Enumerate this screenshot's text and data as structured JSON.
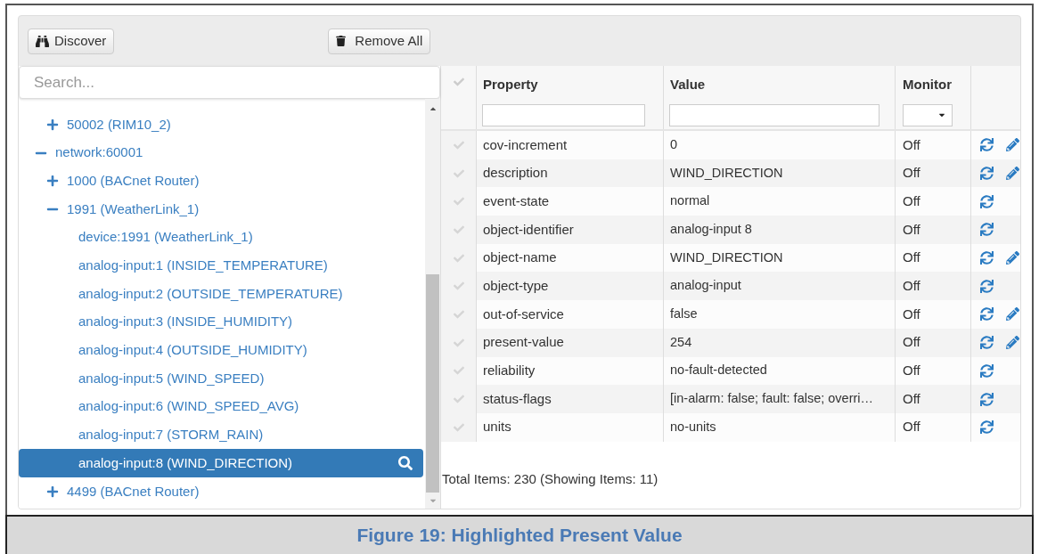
{
  "toolbar": {
    "buttons": [
      {
        "kind": "discover",
        "label": "Discover"
      },
      {
        "kind": "remove",
        "label": "Remove All"
      }
    ]
  },
  "tree": {
    "search": {
      "placeholder": "Search..."
    },
    "scrolled_branch": [
      {
        "label": "50002 (RIM10_2)",
        "expanded": false,
        "selected": false
      }
    ],
    "nodes": [
      {
        "label": "network:60001",
        "expanded": true,
        "selected": false,
        "children": [
          {
            "label": "1000 (BACnet Router)",
            "expanded": false,
            "selected": false
          },
          {
            "label": "1991 (WeatherLink_1)",
            "expanded": true,
            "selected": false,
            "children": [
              {
                "label": "device:1991 (WeatherLink_1)",
                "selected": false
              },
              {
                "label": "analog-input:1 (INSIDE_TEMPERATURE)",
                "selected": false
              },
              {
                "label": "analog-input:2 (OUTSIDE_TEMPERATURE)",
                "selected": false
              },
              {
                "label": "analog-input:3 (INSIDE_HUMIDITY)",
                "selected": false
              },
              {
                "label": "analog-input:4 (OUTSIDE_HUMIDITY)",
                "selected": false
              },
              {
                "label": "analog-input:5 (WIND_SPEED)",
                "selected": false
              },
              {
                "label": "analog-input:6 (WIND_SPEED_AVG)",
                "selected": false
              },
              {
                "label": "analog-input:7 (STORM_RAIN)",
                "selected": false
              },
              {
                "label": "analog-input:8 (WIND_DIRECTION)",
                "selected": true
              }
            ]
          },
          {
            "label": "4499 (BACnet Router)",
            "expanded": false,
            "selected": false
          }
        ]
      }
    ]
  },
  "table": {
    "columns": [
      "Property",
      "Value",
      "Monitor"
    ],
    "rows": [
      {
        "property": "cov-increment",
        "value": "0",
        "monitor": "Off",
        "editable": true
      },
      {
        "property": "description",
        "value": "WIND_DIRECTION",
        "monitor": "Off",
        "editable": true
      },
      {
        "property": "event-state",
        "value": "normal",
        "monitor": "Off",
        "editable": false
      },
      {
        "property": "object-identifier",
        "value": "analog-input 8",
        "monitor": "Off",
        "editable": false
      },
      {
        "property": "object-name",
        "value": "WIND_DIRECTION",
        "monitor": "Off",
        "editable": true
      },
      {
        "property": "object-type",
        "value": "analog-input",
        "monitor": "Off",
        "editable": false
      },
      {
        "property": "out-of-service",
        "value": "false",
        "monitor": "Off",
        "editable": true
      },
      {
        "property": "present-value",
        "value": "254",
        "monitor": "Off",
        "editable": true
      },
      {
        "property": "reliability",
        "value": "no-fault-detected",
        "monitor": "Off",
        "editable": false
      },
      {
        "property": "status-flags",
        "value": "[in-alarm: false; fault: false; overri…",
        "monitor": "Off",
        "editable": false
      },
      {
        "property": "units",
        "value": "no-units",
        "monitor": "Off",
        "editable": false
      }
    ],
    "footer": "Total Items: 230 (Showing Items: 11)"
  },
  "caption": "Figure 19: Highlighted Present Value"
}
